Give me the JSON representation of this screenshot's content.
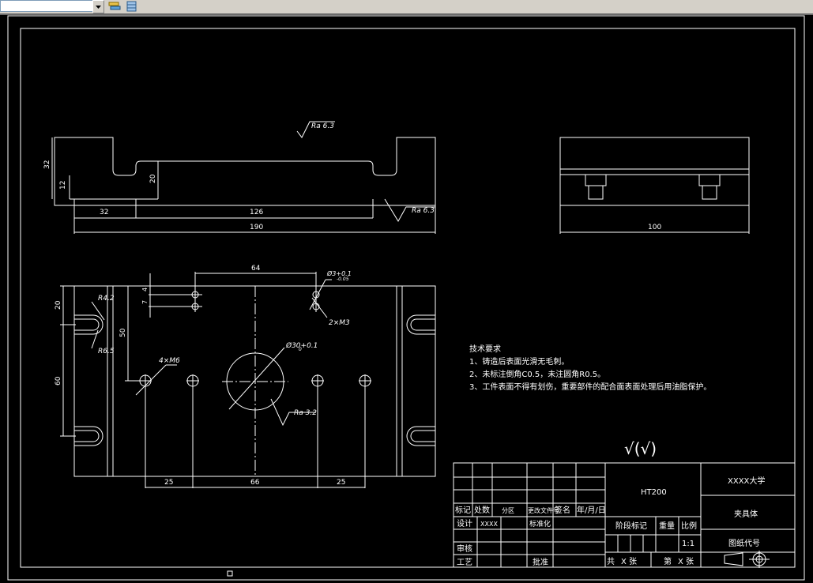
{
  "toolbar": {
    "layer_field": "",
    "icons": [
      "layer-properties-icon",
      "layer-states-icon"
    ]
  },
  "dimensions": {
    "d32h": "32",
    "d12": "12",
    "d20top": "20",
    "d32w": "32",
    "d126": "126",
    "d190": "190",
    "d100": "100",
    "d64": "64",
    "d7": "7",
    "d4": "4",
    "d20side": "20",
    "d50": "50",
    "d60": "60",
    "d25a": "25",
    "d66": "66",
    "d25b": "25"
  },
  "annotations": {
    "ra63_top": "Ra 6.3",
    "ra63_right": "Ra 6.3",
    "ra32": "Ra 3.2",
    "r42": "R4.2",
    "r65": "R6.5",
    "m6": "4×M6",
    "m3": "2×M3",
    "phi3": "Ø3+0.1",
    "phi3_tol": "-0.05",
    "phi30": "Ø30+0.1",
    "phi30_tol": "0"
  },
  "tech": {
    "title": "技术要求",
    "line1": "1、铸造后表面光滑无毛刺。",
    "line2": "2、未标注倒角C0.5，未注圆角R0.5。",
    "line3": "3、工件表面不得有划伤，重要部件的配合面表面处理后用油脂保护。",
    "roughness": "√(√)"
  },
  "title_block": {
    "material": "HT200",
    "school": "XXXX大学",
    "part_name": "夹具体",
    "drawing_no": "图纸代号",
    "biaoji": "标记",
    "chushu": "处数",
    "fenqu": "分区",
    "gengai": "更改文件号",
    "qianming": "签名",
    "nianyueri": "年/月/日",
    "sheji": "设计",
    "designer": "XXXX",
    "biaozhunhua": "标准化",
    "shenhe": "审核",
    "gongyi": "工艺",
    "pizhun": "批准",
    "jieduan": "阶段标记",
    "zhongliang": "重量",
    "bili": "比例",
    "scale": "1:1",
    "gong": "共",
    "zhang1": "X 张",
    "di": "第",
    "zhang2": "X 张"
  }
}
